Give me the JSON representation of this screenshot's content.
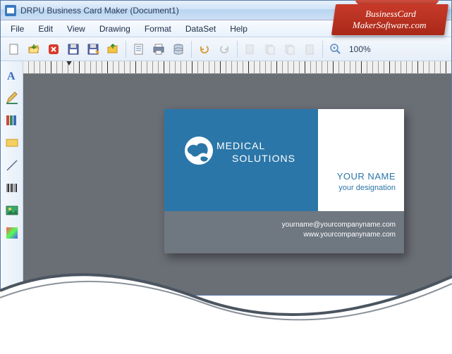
{
  "window": {
    "title": "DRPU Business Card Maker (Document1)"
  },
  "menu": {
    "file": "File",
    "edit": "Edit",
    "view": "View",
    "drawing": "Drawing",
    "format": "Format",
    "dataset": "DataSet",
    "help": "Help"
  },
  "toolbar": {
    "zoom": "100%"
  },
  "card": {
    "title1": "MEDICAL",
    "title2": "SOLUTIONS",
    "name": "YOUR NAME",
    "designation": "your designation",
    "email": "yourname@yourcompanyname.com",
    "website": "www.yourcompanyname.com"
  },
  "ribbon": {
    "line1": "BusinessCard",
    "line2": "MakerSoftware.com"
  }
}
